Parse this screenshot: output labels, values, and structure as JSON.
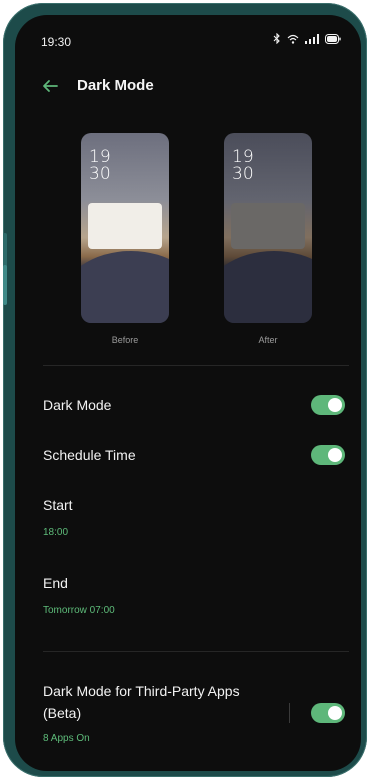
{
  "status_bar": {
    "time": "19:30",
    "icons": [
      "bluetooth-icon",
      "wifi-icon",
      "signal-icon",
      "battery-icon"
    ]
  },
  "header": {
    "title": "Dark Mode",
    "back_icon": "back-arrow-icon"
  },
  "previews": [
    {
      "clock_hour": "19",
      "clock_minute": "30",
      "label": "Before"
    },
    {
      "clock_hour": "19",
      "clock_minute": "30",
      "label": "After"
    }
  ],
  "settings": {
    "dark_mode": {
      "label": "Dark Mode",
      "enabled": true
    },
    "schedule_time": {
      "label": "Schedule Time",
      "enabled": true
    },
    "start": {
      "label": "Start",
      "value": "18:00"
    },
    "end": {
      "label": "End",
      "value": "Tomorrow 07:00"
    },
    "third_party": {
      "label_line1": "Dark Mode for Third-Party Apps",
      "label_line2": "(Beta)",
      "sub": "8 Apps On",
      "enabled": true
    }
  },
  "colors": {
    "accent": "#5eb77a",
    "background": "#0d0d0d",
    "device_frame": "#1d4b4a"
  }
}
